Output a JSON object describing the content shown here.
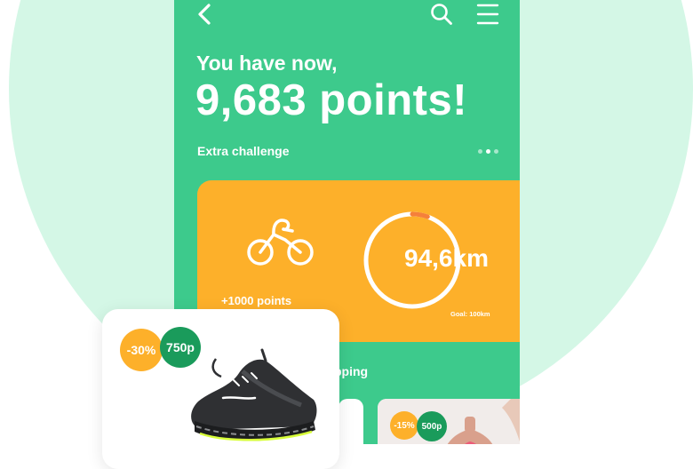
{
  "header": {
    "back_icon": "chevron-left-icon",
    "search_icon": "search-icon",
    "menu_icon": "hamburger-menu-icon"
  },
  "hero": {
    "subtitle": "You have now,",
    "points": "9,683 points!"
  },
  "extra_challenge": {
    "label": "Extra challenge",
    "pager": {
      "count": 3,
      "active_index": 1
    }
  },
  "challenge_card": {
    "activity_icon": "bicycle-icon",
    "reward": "+1000 points",
    "distance": "94,6km",
    "goal": "Goal: 100km",
    "progress": 0.946
  },
  "shopping": {
    "label_visible": "pping"
  },
  "product_card": {
    "discount": "-30%",
    "price": "750p",
    "image": "sneaker-photo"
  },
  "mini_card": {
    "discount": "-15%",
    "price": "500p",
    "image": "athlete-photo"
  },
  "colors": {
    "primary_green": "#3dca8c",
    "accent_orange": "#fdb02a",
    "price_green": "#1a9b5b",
    "background_mint": "#d4f7e6"
  }
}
